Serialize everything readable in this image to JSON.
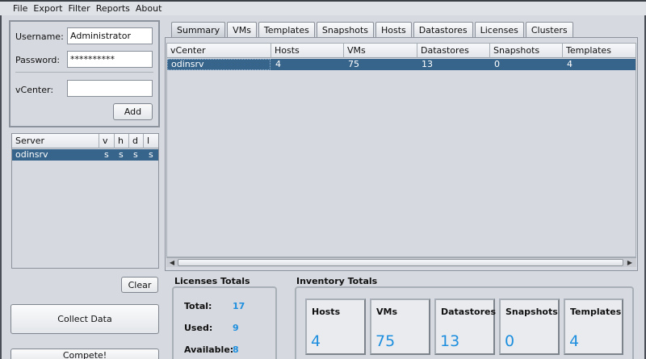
{
  "menu": [
    "File",
    "Export",
    "Filter",
    "Reports",
    "About"
  ],
  "login": {
    "username_label": "Username:",
    "username_value": "Administrator",
    "password_label": "Password:",
    "password_value": "**********",
    "vcenter_label": "vCenter:",
    "vcenter_value": "",
    "add_label": "Add"
  },
  "servers": {
    "columns": [
      "Server",
      "v",
      "h",
      "d",
      "l"
    ],
    "rows": [
      [
        "odinsrv",
        "s",
        "s",
        "s",
        "s"
      ]
    ]
  },
  "buttons": {
    "clear": "Clear",
    "collect": "Collect Data",
    "compete": "Compete!"
  },
  "tabs": [
    "Summary",
    "VMs",
    "Templates",
    "Snapshots",
    "Hosts",
    "Datastores",
    "Licenses",
    "Clusters"
  ],
  "active_tab": "Summary",
  "summary": {
    "columns": [
      "vCenter",
      "Hosts",
      "VMs",
      "Datastores",
      "Snapshots",
      "Templates"
    ],
    "rows": [
      [
        "odinsrv",
        "4",
        "75",
        "13",
        "0",
        "4"
      ]
    ]
  },
  "licenses": {
    "title": "Licenses Totals",
    "total_label": "Total:",
    "total_value": "17",
    "used_label": "Used:",
    "used_value": "9",
    "available_label": "Available:",
    "available_value": "8"
  },
  "inventory": {
    "title": "Inventory Totals",
    "cards": [
      {
        "label": "Hosts",
        "value": "4"
      },
      {
        "label": "VMs",
        "value": "75"
      },
      {
        "label": "Datastores",
        "value": "13"
      },
      {
        "label": "Snapshots",
        "value": "0"
      },
      {
        "label": "Templates",
        "value": "4"
      }
    ]
  },
  "colors": {
    "selection": "#37648a",
    "value_accent": "#1e8fde",
    "background": "#d6d9df"
  }
}
